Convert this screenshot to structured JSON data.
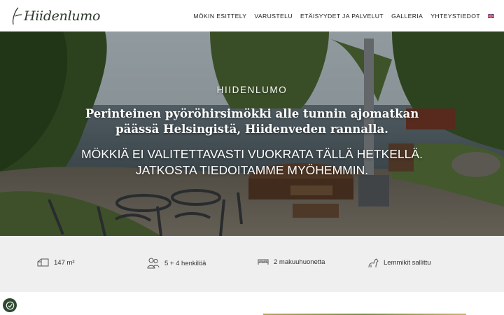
{
  "header": {
    "logo_text": "Hiidenlumo",
    "nav": [
      {
        "label": "MÖKIN ESITTELY"
      },
      {
        "label": "VARUSTELU"
      },
      {
        "label": "ETÄISYYDET JA PALVELUT"
      },
      {
        "label": "GALLERIA"
      },
      {
        "label": "YHTEYSTIEDOT"
      }
    ],
    "language_icon": "uk-flag-icon"
  },
  "hero": {
    "kicker": "HIIDENLUMO",
    "headline": "Perinteinen pyöröhirsimökki alle tunnin ajomatkan päässä Helsingistä, Hiidenveden rannalla.",
    "notice": "MÖKKIÄ EI VALITETTAVASTI VUOKRATA TÄLLÄ HETKELLÄ. JATKOSTA TIEDOITAMME MYÖHEMMIN."
  },
  "features": [
    {
      "icon": "area-icon",
      "text": "147 m²"
    },
    {
      "icon": "people-icon",
      "text": "5 + 4 henkilöä"
    },
    {
      "icon": "bed-icon",
      "text": "2 makuuhuonetta"
    },
    {
      "icon": "pet-icon",
      "text": "Lemmikit sallittu"
    }
  ],
  "colors": {
    "brand": "#2e4a30",
    "feature_bar": "#efefef"
  }
}
